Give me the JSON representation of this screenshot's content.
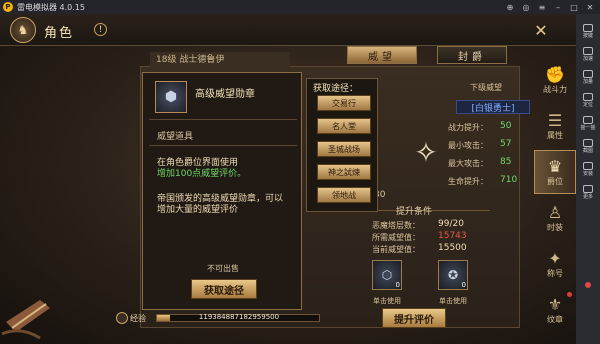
{
  "emulator": {
    "title": "雷电模拟器 4.0.15",
    "sidebar": [
      "按键",
      "加速",
      "加量",
      "定位",
      "摇一摇",
      "截图",
      "安装",
      "更多"
    ]
  },
  "header": {
    "title": "角色",
    "avatar_glyph": "♞",
    "level_strip": "18级  战士德鲁伊"
  },
  "tabs": {
    "prestige": "威望",
    "title": "封爵"
  },
  "popup": {
    "item_name": "高级威望勋章",
    "item_type": "威望道具",
    "desc_line1": "在角色爵位界面使用",
    "desc_line1_highlight": "增加100点威望评价。",
    "desc_line2a": "帝国颁发的高级威望勋章，可以",
    "desc_line2b": "增加大量的威望评价",
    "not_sellable": "不可出售",
    "obtain_button": "获取途径"
  },
  "routes": {
    "title": "获取途径：",
    "items": [
      "交易行",
      "名人堂",
      "圣城战场",
      "神之試煉",
      "领地战"
    ]
  },
  "rank": {
    "next_label": "下级威望",
    "name": "[白银勇士]",
    "stats": [
      {
        "label": "战力提升：",
        "value": "50"
      },
      {
        "label": "最小攻击：",
        "value": "57"
      },
      {
        "label": "最大攻击：",
        "value": "85"
      },
      {
        "label": "生命提升：",
        "value": "710"
      }
    ],
    "partial_value": "30"
  },
  "conditions": {
    "title": "提升条件",
    "rows": [
      {
        "label": "恶魔塔层数：",
        "value": "99/20",
        "color": "#f0dcb4"
      },
      {
        "label": "所需威望值：",
        "value": "15743",
        "color": "#e05a4a"
      },
      {
        "label": "当前威望值：",
        "value": "15500",
        "color": "#f0dcb4"
      }
    ],
    "slots": [
      {
        "count": "0",
        "label": "单击使用"
      },
      {
        "count": "0",
        "label": "单击使用"
      }
    ],
    "promote_button": "提升评价"
  },
  "experience": {
    "label": "经验",
    "value": "119384887182959500",
    "progress": 0.08
  },
  "game_nav": [
    {
      "label": "战斗力",
      "glyph": "✊"
    },
    {
      "label": "属性",
      "glyph": "☰"
    },
    {
      "label": "爵位",
      "glyph": "♛",
      "active": true
    },
    {
      "label": "时装",
      "glyph": "♙"
    },
    {
      "label": "称号",
      "glyph": "✦"
    },
    {
      "label": "纹章",
      "glyph": "⚜"
    }
  ]
}
